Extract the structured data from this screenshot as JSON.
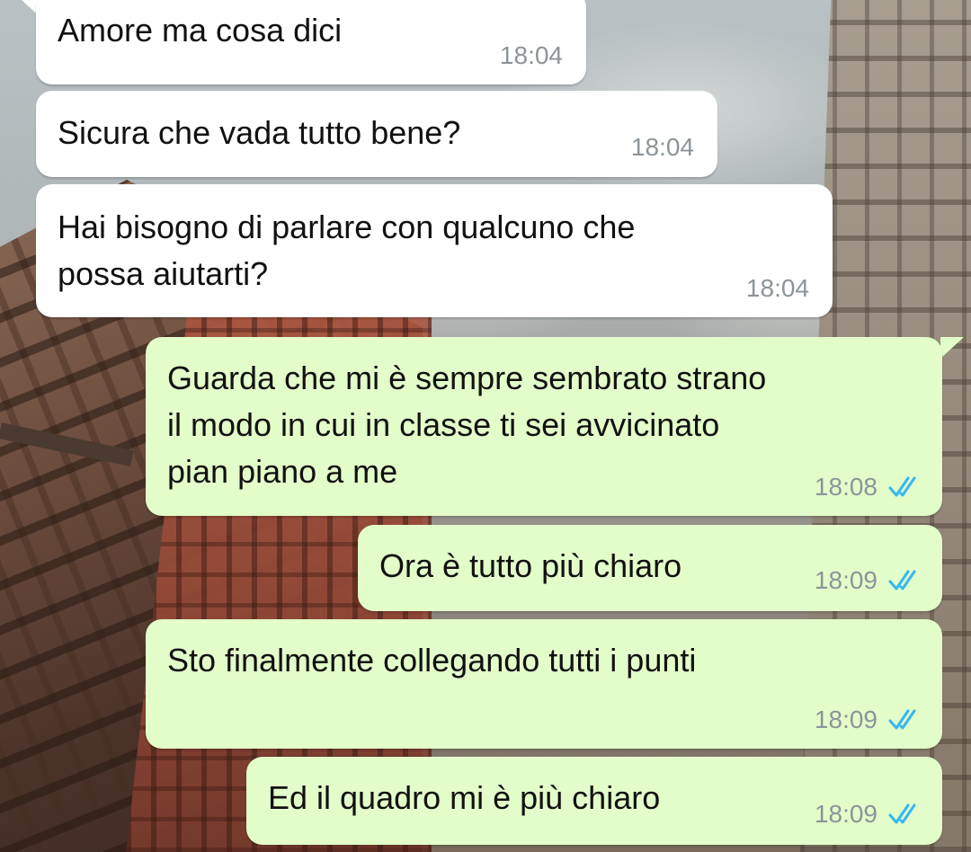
{
  "colors": {
    "incoming_bubble": "#ffffff",
    "outgoing_bubble": "#e2fdc9",
    "timestamp": "#8c9499",
    "read_ticks": "#34b7f1"
  },
  "messages": [
    {
      "direction": "incoming",
      "text": "Amore ma cosa dici",
      "time": "18:04"
    },
    {
      "direction": "incoming",
      "text": "Sicura che vada tutto bene?",
      "time": "18:04"
    },
    {
      "direction": "incoming",
      "text": "Hai bisogno di parlare con qualcuno che\npossa aiutarti?",
      "time": "18:04"
    },
    {
      "direction": "outgoing",
      "text": "Guarda che mi è sempre sembrato strano\nil modo in cui in classe ti sei avvicinato\npian piano a me",
      "time": "18:08",
      "status_icon": "double-check-read-icon"
    },
    {
      "direction": "outgoing",
      "text": "Ora è tutto più chiaro",
      "time": "18:09",
      "status_icon": "double-check-read-icon"
    },
    {
      "direction": "outgoing",
      "text": "Sto finalmente collegando tutti i punti",
      "time": "18:09",
      "status_icon": "double-check-read-icon"
    },
    {
      "direction": "outgoing",
      "text": "Ed il quadro mi è più chiaro",
      "time": "18:09",
      "status_icon": "double-check-read-icon"
    }
  ]
}
